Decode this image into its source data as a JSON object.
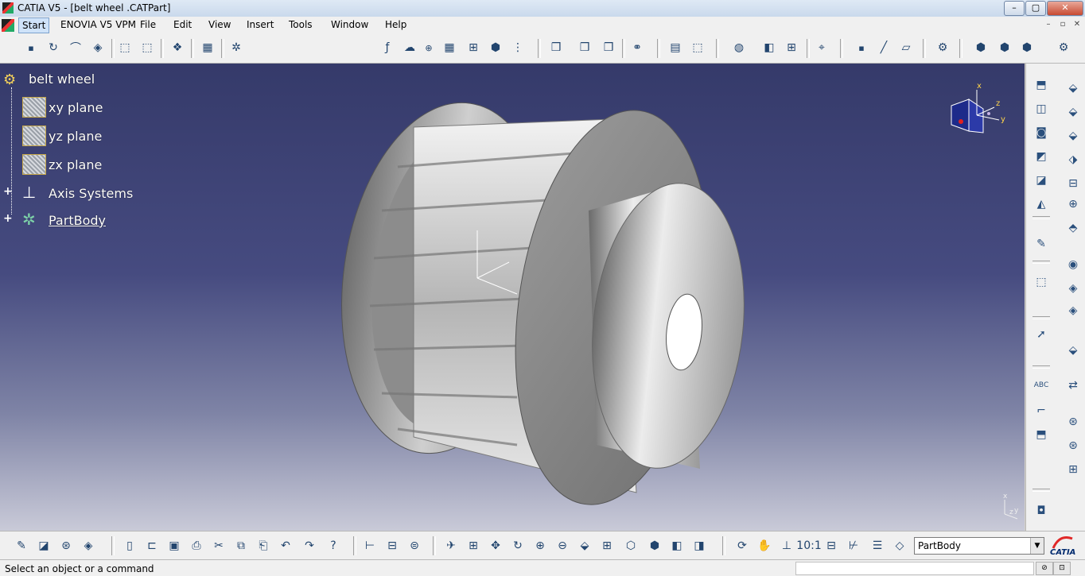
{
  "window": {
    "title": "CATIA V5 - [belt wheel .CATPart]",
    "controls": {
      "minimize": "–",
      "maximize": "▢",
      "close": "✕"
    }
  },
  "menubar": {
    "items": [
      "Start",
      "ENOVIA V5 VPM",
      "File",
      "Edit",
      "View",
      "Insert",
      "Tools",
      "Window",
      "Help"
    ],
    "mdi_controls": [
      "–",
      "▫",
      "✕"
    ]
  },
  "tree": {
    "root": "belt wheel",
    "items": [
      {
        "label": "xy plane",
        "icon": "plane-icon"
      },
      {
        "label": "yz plane",
        "icon": "plane-icon"
      },
      {
        "label": "zx plane",
        "icon": "plane-icon"
      },
      {
        "label": "Axis Systems",
        "icon": "axis-system-icon",
        "expandable": true
      },
      {
        "label": "PartBody",
        "icon": "part-body-icon",
        "expandable": true
      }
    ]
  },
  "compass": {
    "x_label": "x",
    "y_label": "y",
    "z_label": "z"
  },
  "triad": {
    "x_label": "x",
    "y_label": "y",
    "z_label": "z"
  },
  "corner_axes": {
    "x_label": "x",
    "z_label": "z",
    "y_label": "y"
  },
  "bottom_toolbar": {
    "current_body": "PartBody"
  },
  "status": {
    "message": "Select an object or a command"
  },
  "colors": {
    "background_top": "#353a6a",
    "background_bottom": "#c9cad8",
    "tree_text": "#ffffff",
    "toolbar_bg": "#f0f0f0"
  }
}
